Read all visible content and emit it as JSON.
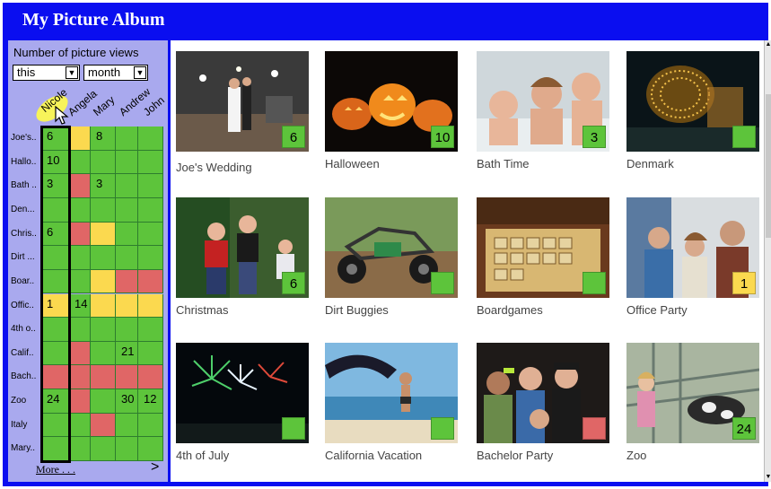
{
  "app": {
    "title": "My Picture Album"
  },
  "colors": {
    "brand": "#0a0ef0",
    "green": "#5dc43b",
    "red": "#e06666",
    "yellow": "#fbd94f",
    "sidebar": "#a9a9ee"
  },
  "sidebar": {
    "title": "Number of picture views",
    "period_select": "this",
    "unit_select": "month",
    "columns": [
      "Nicole",
      "Angela",
      "Mary",
      "Andrew",
      "John"
    ],
    "rows": [
      {
        "label": "Joe's..",
        "cells": [
          {
            "v": "6",
            "c": "green"
          },
          {
            "v": "",
            "c": "yellow"
          },
          {
            "v": "8",
            "c": "green"
          },
          {
            "v": "",
            "c": "green"
          },
          {
            "v": "",
            "c": "green"
          }
        ]
      },
      {
        "label": "Hallo..",
        "cells": [
          {
            "v": "10",
            "c": "green"
          },
          {
            "v": "",
            "c": "green"
          },
          {
            "v": "",
            "c": "green"
          },
          {
            "v": "",
            "c": "green"
          },
          {
            "v": "",
            "c": "green"
          }
        ]
      },
      {
        "label": "Bath ..",
        "cells": [
          {
            "v": "3",
            "c": "green"
          },
          {
            "v": "",
            "c": "red"
          },
          {
            "v": "3",
            "c": "green"
          },
          {
            "v": "",
            "c": "green"
          },
          {
            "v": "",
            "c": "green"
          }
        ]
      },
      {
        "label": "Den...",
        "cells": [
          {
            "v": "",
            "c": "green"
          },
          {
            "v": "",
            "c": "green"
          },
          {
            "v": "",
            "c": "green"
          },
          {
            "v": "",
            "c": "green"
          },
          {
            "v": "",
            "c": "green"
          }
        ]
      },
      {
        "label": "Chris..",
        "cells": [
          {
            "v": "6",
            "c": "green"
          },
          {
            "v": "",
            "c": "red"
          },
          {
            "v": "",
            "c": "yellow"
          },
          {
            "v": "",
            "c": "green"
          },
          {
            "v": "",
            "c": "green"
          }
        ]
      },
      {
        "label": "Dirt ...",
        "cells": [
          {
            "v": "",
            "c": "green"
          },
          {
            "v": "",
            "c": "green"
          },
          {
            "v": "",
            "c": "green"
          },
          {
            "v": "",
            "c": "green"
          },
          {
            "v": "",
            "c": "green"
          }
        ]
      },
      {
        "label": "Boar..",
        "cells": [
          {
            "v": "",
            "c": "green"
          },
          {
            "v": "",
            "c": "green"
          },
          {
            "v": "",
            "c": "yellow"
          },
          {
            "v": "",
            "c": "red"
          },
          {
            "v": "",
            "c": "red"
          }
        ]
      },
      {
        "label": "Offic..",
        "cells": [
          {
            "v": "1",
            "c": "yellow"
          },
          {
            "v": "14",
            "c": "green"
          },
          {
            "v": "",
            "c": "yellow"
          },
          {
            "v": "",
            "c": "yellow"
          },
          {
            "v": "",
            "c": "yellow"
          }
        ]
      },
      {
        "label": "4th o..",
        "cells": [
          {
            "v": "",
            "c": "green"
          },
          {
            "v": "",
            "c": "green"
          },
          {
            "v": "",
            "c": "green"
          },
          {
            "v": "",
            "c": "green"
          },
          {
            "v": "",
            "c": "green"
          }
        ]
      },
      {
        "label": "Calif..",
        "cells": [
          {
            "v": "",
            "c": "green"
          },
          {
            "v": "",
            "c": "red"
          },
          {
            "v": "",
            "c": "green"
          },
          {
            "v": "21",
            "c": "green"
          },
          {
            "v": "",
            "c": "green"
          }
        ]
      },
      {
        "label": "Bach..",
        "cells": [
          {
            "v": "",
            "c": "red"
          },
          {
            "v": "",
            "c": "red"
          },
          {
            "v": "",
            "c": "red"
          },
          {
            "v": "",
            "c": "red"
          },
          {
            "v": "",
            "c": "red"
          }
        ]
      },
      {
        "label": "Zoo",
        "cells": [
          {
            "v": "24",
            "c": "green"
          },
          {
            "v": "",
            "c": "red"
          },
          {
            "v": "",
            "c": "green"
          },
          {
            "v": "30",
            "c": "green"
          },
          {
            "v": "12",
            "c": "green"
          }
        ]
      },
      {
        "label": "Italy",
        "cells": [
          {
            "v": "",
            "c": "green"
          },
          {
            "v": "",
            "c": "green"
          },
          {
            "v": "",
            "c": "red"
          },
          {
            "v": "",
            "c": "green"
          },
          {
            "v": "",
            "c": "green"
          }
        ]
      },
      {
        "label": "Mary..",
        "cells": [
          {
            "v": "",
            "c": "green"
          },
          {
            "v": "",
            "c": "green"
          },
          {
            "v": "",
            "c": "green"
          },
          {
            "v": "",
            "c": "green"
          },
          {
            "v": "",
            "c": "green"
          }
        ]
      }
    ],
    "more_label": "More . . .",
    "more_arrow": ">"
  },
  "albums": [
    {
      "caption": "Joe's Wedding",
      "badge": "6",
      "badge_color": "green",
      "icon": "wedding-photo"
    },
    {
      "caption": "Halloween",
      "badge": "10",
      "badge_color": "green",
      "icon": "pumpkins-photo"
    },
    {
      "caption": "Bath Time",
      "badge": "3",
      "badge_color": "green",
      "icon": "kids-bath-photo"
    },
    {
      "caption": "Denmark",
      "badge": "",
      "badge_color": "green",
      "icon": "lit-tree-photo"
    },
    {
      "caption": "Christmas",
      "badge": "6",
      "badge_color": "green",
      "icon": "kids-christmas-photo"
    },
    {
      "caption": "Dirt Buggies",
      "badge": "",
      "badge_color": "green",
      "icon": "buggy-photo"
    },
    {
      "caption": "Boardgames",
      "badge": "",
      "badge_color": "green",
      "icon": "boardgame-photo"
    },
    {
      "caption": "Office Party",
      "badge": "1",
      "badge_color": "yellow",
      "icon": "office-party-photo"
    },
    {
      "caption": "4th of July",
      "badge": "",
      "badge_color": "green",
      "icon": "fireworks-photo"
    },
    {
      "caption": "California Vacation",
      "badge": "",
      "badge_color": "green",
      "icon": "beach-photo"
    },
    {
      "caption": "Bachelor Party",
      "badge": "",
      "badge_color": "red",
      "icon": "party-group-photo"
    },
    {
      "caption": "Zoo",
      "badge": "24",
      "badge_color": "green",
      "icon": "zoo-photo"
    }
  ]
}
